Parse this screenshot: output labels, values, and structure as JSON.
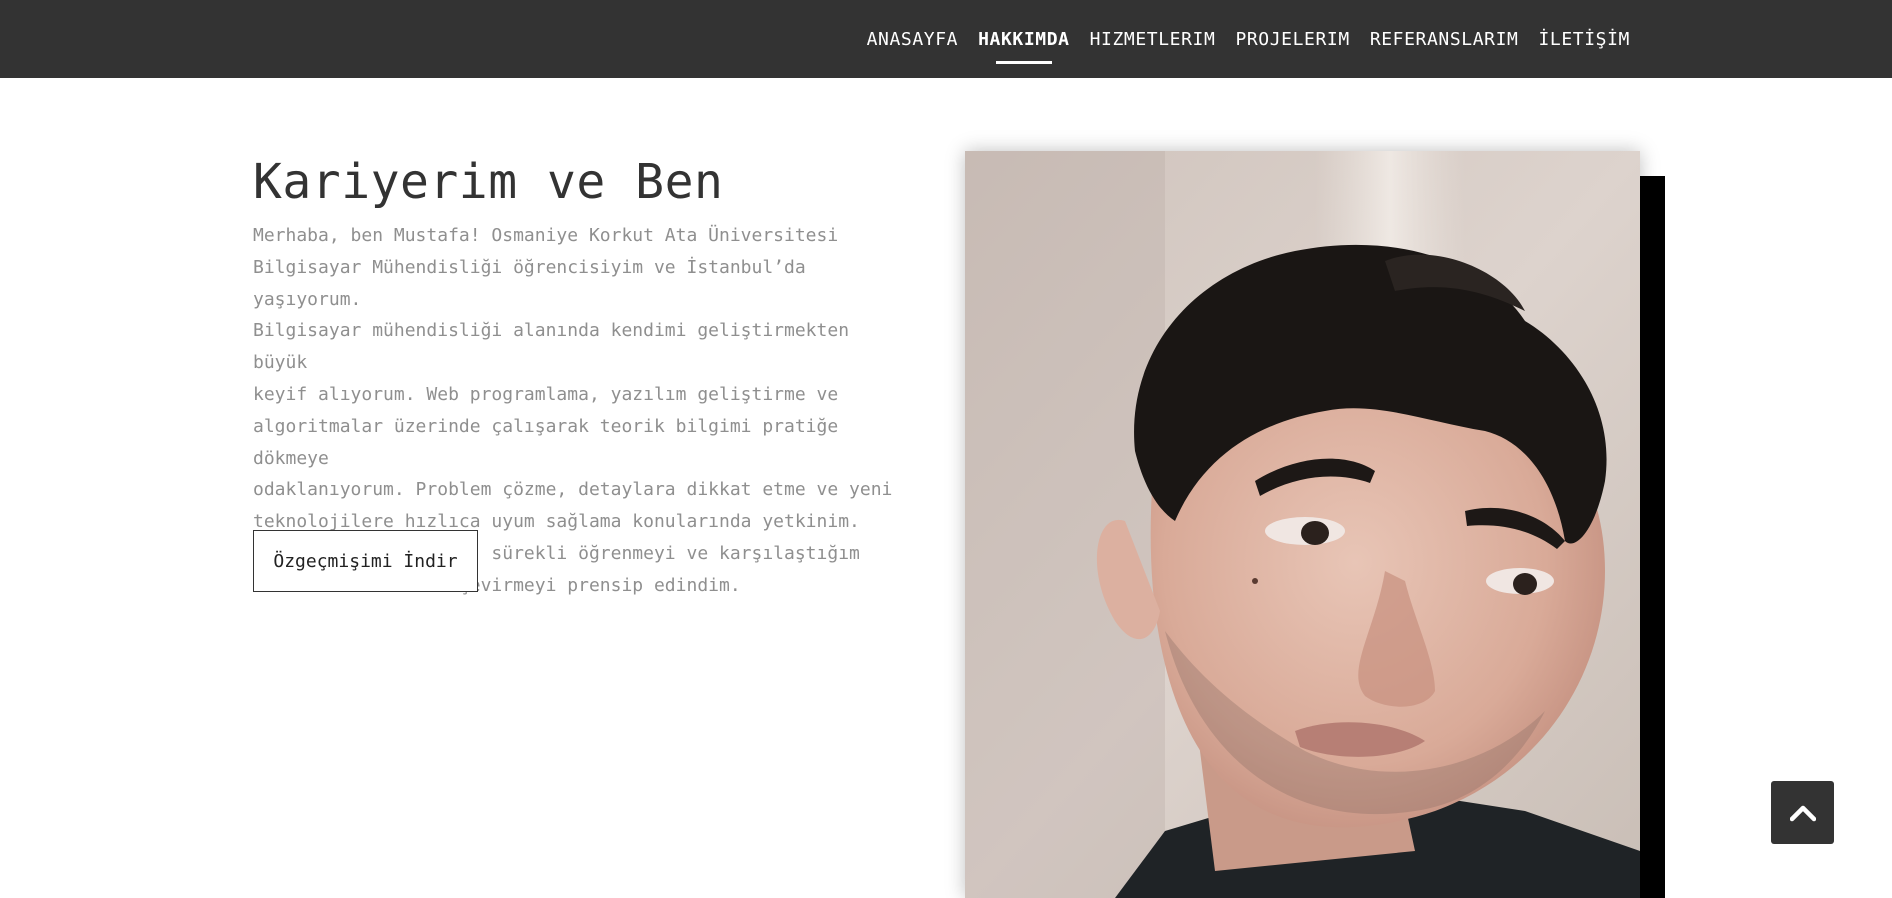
{
  "nav": {
    "items": [
      {
        "label": "ANASAYFA",
        "active": false
      },
      {
        "label": "HAKKIMDA",
        "active": true
      },
      {
        "label": "HIZMETLERIM",
        "active": false
      },
      {
        "label": "PROJELERIM",
        "active": false
      },
      {
        "label": "REFERANSLARIM",
        "active": false
      },
      {
        "label": "İLETİŞİM",
        "active": false
      }
    ]
  },
  "about": {
    "title": "Kariyerim ve Ben",
    "lines": [
      "Merhaba, ben Mustafa! Osmaniye Korkut Ata Üniversitesi",
      "Bilgisayar Mühendisliği öğrencisiyim ve İstanbul’da yaşıyorum.",
      "Bilgisayar mühendisliği alanında kendimi geliştirmekten büyük",
      "keyif alıyorum. Web programlama, yazılım geliştirme ve",
      "algoritmalar üzerinde çalışarak teorik bilgimi pratiğe dökmeye",
      "odaklanıyorum. Problem çözme, detaylara dikkat etme ve yeni",
      "teknolojilere hızlıca uyum sağlama konularında yetkinim.",
      "Disiplinli çalışmayı, sürekli öğrenmeyi ve karşılaştığım",
      "zorlukları fırsata çevirmeyi prensip edindim."
    ],
    "cv_button_label": "Özgeçmişimi İndir"
  },
  "icons": {
    "scroll_top": "chevron-up-icon"
  },
  "colors": {
    "navbar_bg": "#333333",
    "text_dark": "#333333",
    "text_muted": "#8f8f8f",
    "accent_block": "#000000"
  }
}
